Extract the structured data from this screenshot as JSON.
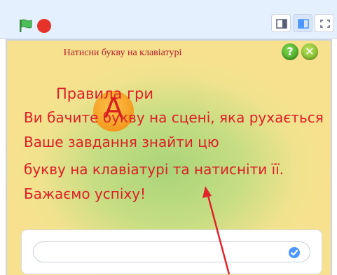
{
  "toolbar": {
    "green_flag_icon": "green-flag-icon",
    "stop_icon": "stop-icon",
    "small_stage_icon": "small-stage-icon",
    "normal_stage_icon": "normal-stage-icon",
    "fullscreen_icon": "fullscreen-icon"
  },
  "stage": {
    "title": "Натисни букву на клавіатурі",
    "help_symbol": "?",
    "close_symbol": "✕",
    "sprite_letter": "А",
    "rules_heading": "Правила гри",
    "rules_lines": [
      "Ви бачите букву на сцені, яка рухається",
      "Ваше завдання знайти цю",
      "букву на клавіатурі  та натисніти її.",
      "Бажаємо успіху!"
    ]
  },
  "colors": {
    "text_red": "#dc1f26",
    "title_red": "#b01e28",
    "flag_green": "#4cbf56",
    "stop_red": "#e6332a",
    "accent_blue": "#4c97ff",
    "arrow_red": "#e0242a"
  }
}
